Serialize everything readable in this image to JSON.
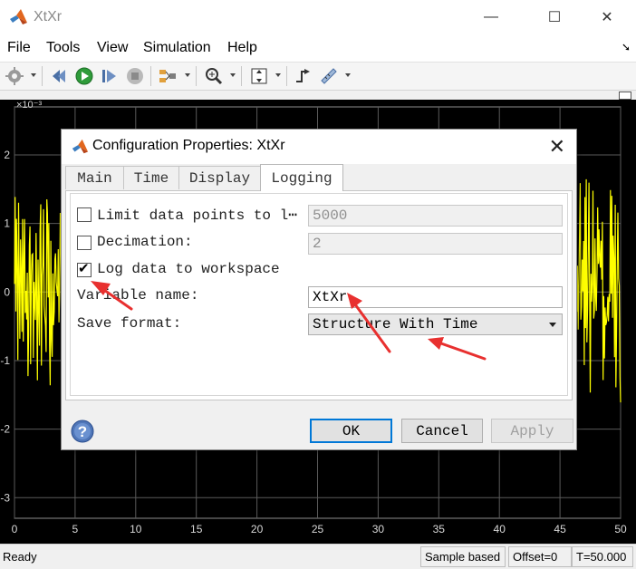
{
  "window": {
    "title": "XtXr",
    "minimize": "—",
    "maximize": "☐",
    "close": "✕"
  },
  "menu": {
    "items": [
      "File",
      "Tools",
      "View",
      "Simulation",
      "Help"
    ],
    "undock": "➘"
  },
  "toolbar": {
    "icons": [
      "settings-icon",
      "restore-icon",
      "run-icon",
      "step-forward-icon",
      "stop-icon",
      "signal-selector-icon",
      "zoom-in-icon",
      "fit-axes-icon",
      "triggers-icon",
      "measurements-icon"
    ]
  },
  "scope": {
    "exponent_label": "×10⁻³",
    "line_color": "#ffff00",
    "grid_color": "#5a5a5a",
    "y_ticks": [
      "2",
      "1",
      "0",
      "-1",
      "-2",
      "-3"
    ],
    "x_ticks": [
      "0",
      "5",
      "10",
      "15",
      "20",
      "25",
      "30",
      "35",
      "40",
      "45",
      "50"
    ],
    "xlim": [
      0,
      50
    ],
    "ylim": [
      -3.3,
      2.7
    ]
  },
  "dialog": {
    "title": "Configuration Properties: XtXr",
    "close": "✕",
    "tabs": [
      "Main",
      "Time",
      "Display",
      "Logging"
    ],
    "active_tab": "Logging",
    "limit_label": "Limit data points to l⋯",
    "limit_value": "5000",
    "limit_checked": false,
    "decimation_label": "Decimation:",
    "decimation_value": "2",
    "decimation_checked": false,
    "log_label": "Log data to workspace",
    "log_checked": true,
    "varname_label": "Variable name:",
    "varname_value": "XtXr",
    "format_label": "Save format:",
    "format_value": "Structure With Time",
    "help": "?",
    "ok": "OK",
    "cancel": "Cancel",
    "apply": "Apply"
  },
  "status": {
    "state": "Ready",
    "mode": "Sample based",
    "offset": "Offset=0",
    "time": "T=50.000"
  },
  "colors": {
    "accent": "#0078d7",
    "annotation": "#e8302f"
  }
}
